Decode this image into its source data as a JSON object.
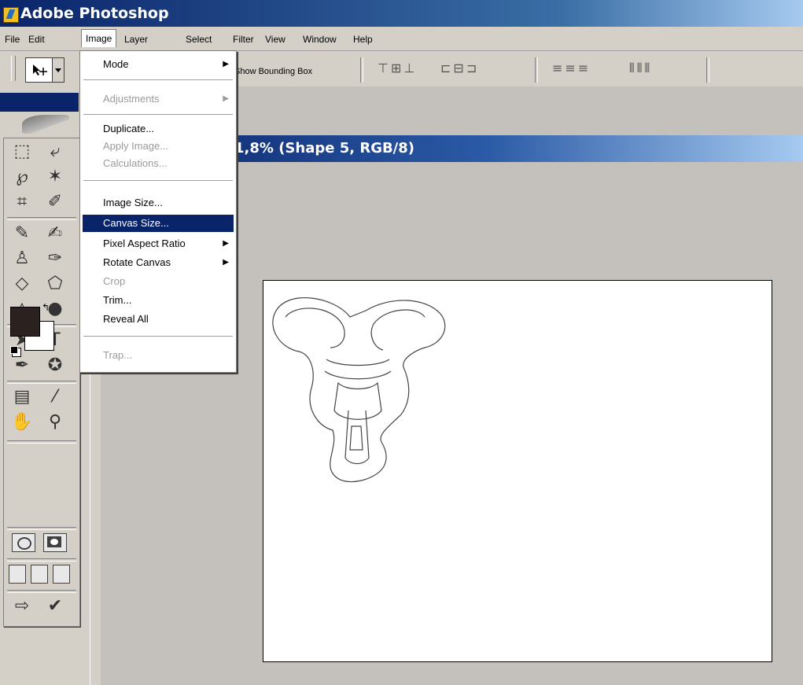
{
  "window": {
    "title": "Adobe Photoshop"
  },
  "menubar": [
    "File",
    "Edit",
    "Image",
    "Layer",
    "Select",
    "Filter",
    "View",
    "Window",
    "Help"
  ],
  "active_menu": "Image",
  "options_bar": {
    "show_bounding_box": "Show Bounding Box"
  },
  "document": {
    "title_fragment": "1,8% (Shape 5, RGB/8)"
  },
  "image_menu": {
    "mode": "Mode",
    "adjustments": "Adjustments",
    "duplicate": "Duplicate...",
    "apply_image": "Apply Image...",
    "calculations": "Calculations...",
    "image_size": "Image Size...",
    "canvas_size": "Canvas Size...",
    "pixel_aspect_ratio": "Pixel Aspect Ratio",
    "rotate_canvas": "Rotate Canvas",
    "crop": "Crop",
    "trim": "Trim...",
    "reveal_all": "Reveal All",
    "trap": "Trap..."
  },
  "colors": {
    "foreground": "#2b2220",
    "background": "#ffffff",
    "highlight": "#0a246a"
  },
  "icons": [
    "marquee-icon",
    "move-icon",
    "lasso-icon",
    "magic-wand-icon",
    "crop-icon",
    "slice-icon",
    "healing-brush-icon",
    "brush-icon",
    "clone-stamp-icon",
    "history-brush-icon",
    "eraser-icon",
    "paint-bucket-icon",
    "blur-icon",
    "dodge-icon",
    "path-select-icon",
    "type-icon",
    "pen-icon",
    "custom-shape-icon",
    "notes-icon",
    "eyedropper-icon",
    "hand-icon",
    "zoom-icon"
  ]
}
